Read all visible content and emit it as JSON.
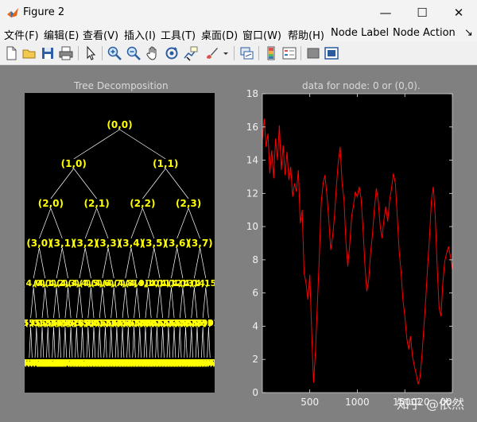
{
  "window": {
    "title": "Figure 2",
    "controls": {
      "minimize": "—",
      "maximize": "☐",
      "close": "✕"
    }
  },
  "menu": {
    "items": [
      "文件(F)",
      "编辑(E)",
      "查看(V)",
      "插入(I)",
      "工具(T)",
      "桌面(D)",
      "窗口(W)",
      "帮助(H)",
      "Node Label",
      "Node Action",
      "↘"
    ]
  },
  "toolbar": {
    "icons": [
      "new-figure-icon",
      "open-file-icon",
      "save-icon",
      "print-icon",
      "pointer-icon",
      "zoom-in-icon",
      "zoom-out-icon",
      "pan-icon",
      "rotate-3d-icon",
      "data-cursor-icon",
      "brush-icon",
      "dropdown-arrow-icon",
      "link-plot-icon",
      "insert-colorbar-icon",
      "insert-legend-icon",
      "hide-plot-tools-icon",
      "show-plot-tools-icon"
    ]
  },
  "tree": {
    "title": "Tree Decomposition",
    "levels": [
      [
        "(0,0)"
      ],
      [
        "(1,0)",
        "(1,1)"
      ],
      [
        "(2,0)",
        "(2,1)",
        "(2,2)",
        "(2,3)"
      ],
      [
        "(3,0)",
        "(3,1)",
        "(3,2)",
        "(3,3)",
        "(3,4)",
        "(3,5)",
        "(3,6)",
        "(3,7)"
      ],
      [
        "(4,0)",
        "(4,1)",
        "(4,2)",
        "(4,3)",
        "(4,4)",
        "(4,5)",
        "(4,6)",
        "(4,7)",
        "(4,8)",
        "(4,9)",
        "(4,10)",
        "(4,11)",
        "(4,12)",
        "(4,13)",
        "(4,14)",
        "(4,15)"
      ],
      [
        "(5,0)",
        "(5,1)",
        "(5,2)",
        "(5,3)",
        "(5,4)",
        "(5,5)",
        "(5,6)",
        "(5,7)",
        "(5,8)",
        "(5,9)",
        "(5,10)",
        "(5,11)",
        "(5,12)",
        "(5,13)",
        "(5,14)",
        "(5,15)",
        "(5,16)",
        "(5,17)",
        "(5,18)",
        "(5,19)",
        "(5,20)",
        "(5,21)",
        "(5,22)",
        "(5,23)",
        "(5,24)",
        "(5,25)",
        "(5,26)",
        "(5,27)",
        "(5,28)",
        "(5,29)",
        "(5,30)",
        "(5,31)"
      ],
      [
        "(6,0)",
        "(6,1)",
        "(6,2)",
        "(6,3)",
        "(6,4)",
        "(6,5)",
        "(6,6)",
        "(6,7)",
        "(6,8)",
        "(6,9)",
        "(6,10)",
        "(6,11)",
        "(6,12)",
        "(6,13)",
        "(6,14)",
        "(6,15)",
        "(6,16)",
        "(6,17)",
        "(6,18)",
        "(6,19)",
        "(6,20)",
        "(6,21)",
        "(6,22)",
        "(6,23)",
        "(6,24)",
        "(6,25)",
        "(6,26)",
        "(6,27)",
        "(6,28)",
        "(6,29)",
        "(6,30)",
        "(6,31)",
        "(6,32)",
        "(6,33)",
        "(6,34)",
        "(6,35)",
        "(6,36)",
        "(6,37)",
        "(6,38)",
        "(6,39)",
        "(6,40)",
        "(6,41)",
        "(6,42)",
        "(6,43)",
        "(6,44)",
        "(6,45)",
        "(6,46)",
        "(6,47)",
        "(6,48)",
        "(6,49)",
        "(6,50)",
        "(6,51)",
        "(6,52)",
        "(6,53)",
        "(6,54)",
        "(6,55)",
        "(6,56)",
        "(6,57)",
        "(6,58)",
        "(6,59)",
        "(6,60)",
        "(6,61)",
        "(6,62)",
        "(6,63)"
      ]
    ],
    "label_color": "#ffff00",
    "edge_color": "#ffffff"
  },
  "chart_data": {
    "type": "line",
    "title": "data for node: 0 or (0,0).",
    "xlabel": "",
    "ylabel": "",
    "xlim": [
      1,
      2000
    ],
    "ylim": [
      0,
      18
    ],
    "xticks": [
      500,
      1000,
      1500,
      2000
    ],
    "xtick_labels": [
      "500",
      "1000",
      "1500",
      "20",
      "00"
    ],
    "yticks": [
      0,
      2,
      4,
      6,
      8,
      10,
      12,
      14,
      16,
      18
    ],
    "grid": false,
    "line_color": "#ff0000",
    "series": [
      {
        "x": [
          1,
          20,
          40,
          60,
          80,
          100,
          120,
          140,
          160,
          180,
          200,
          220,
          240,
          260,
          280,
          300,
          320,
          340,
          360,
          380,
          400,
          420,
          440,
          460,
          480,
          500,
          520,
          540,
          560,
          580,
          600,
          620,
          640,
          660,
          680,
          700,
          720,
          740,
          760,
          780,
          800,
          820,
          840,
          860,
          880,
          900,
          920,
          940,
          960,
          980,
          1000,
          1020,
          1040,
          1060,
          1080,
          1100,
          1120,
          1140,
          1160,
          1180,
          1200,
          1220,
          1240,
          1260,
          1280,
          1300,
          1320,
          1340,
          1360,
          1380,
          1400,
          1420,
          1440,
          1460,
          1480,
          1500,
          1520,
          1540,
          1560,
          1580,
          1600,
          1620,
          1640,
          1660,
          1680,
          1700,
          1720,
          1740,
          1760,
          1780,
          1800,
          1820,
          1840,
          1860,
          1880,
          1900,
          1920,
          1940,
          1960,
          1980,
          2000
        ],
        "y": [
          15.2,
          16.5,
          14.8,
          15.6,
          13.2,
          14.6,
          12.9,
          15.3,
          14.0,
          16.1,
          13.4,
          14.9,
          13.1,
          14.5,
          12.8,
          13.6,
          11.8,
          12.6,
          12.1,
          13.4,
          10.2,
          11.0,
          7.2,
          6.6,
          5.6,
          7.1,
          3.6,
          0.6,
          2.5,
          5.3,
          8.1,
          11.4,
          12.6,
          13.1,
          11.9,
          10.4,
          8.6,
          9.4,
          10.6,
          12.4,
          13.9,
          14.8,
          12.6,
          11.6,
          9.1,
          7.6,
          8.9,
          10.6,
          11.3,
          12.1,
          11.8,
          12.4,
          11.7,
          9.9,
          7.7,
          6.1,
          6.8,
          8.4,
          9.6,
          11.1,
          12.3,
          11.6,
          10.1,
          9.3,
          10.4,
          11.2,
          10.3,
          11.6,
          12.3,
          13.2,
          12.6,
          10.6,
          8.6,
          7.3,
          5.6,
          4.6,
          3.3,
          2.6,
          3.4,
          2.2,
          1.6,
          1.1,
          0.5,
          0.9,
          2.2,
          3.9,
          5.6,
          7.6,
          9.4,
          11.6,
          12.4,
          10.6,
          7.6,
          5.1,
          4.6,
          6.6,
          7.9,
          8.4,
          8.8,
          8.2,
          7.4
        ]
      }
    ],
    "watermark": "知乎 @依然"
  }
}
